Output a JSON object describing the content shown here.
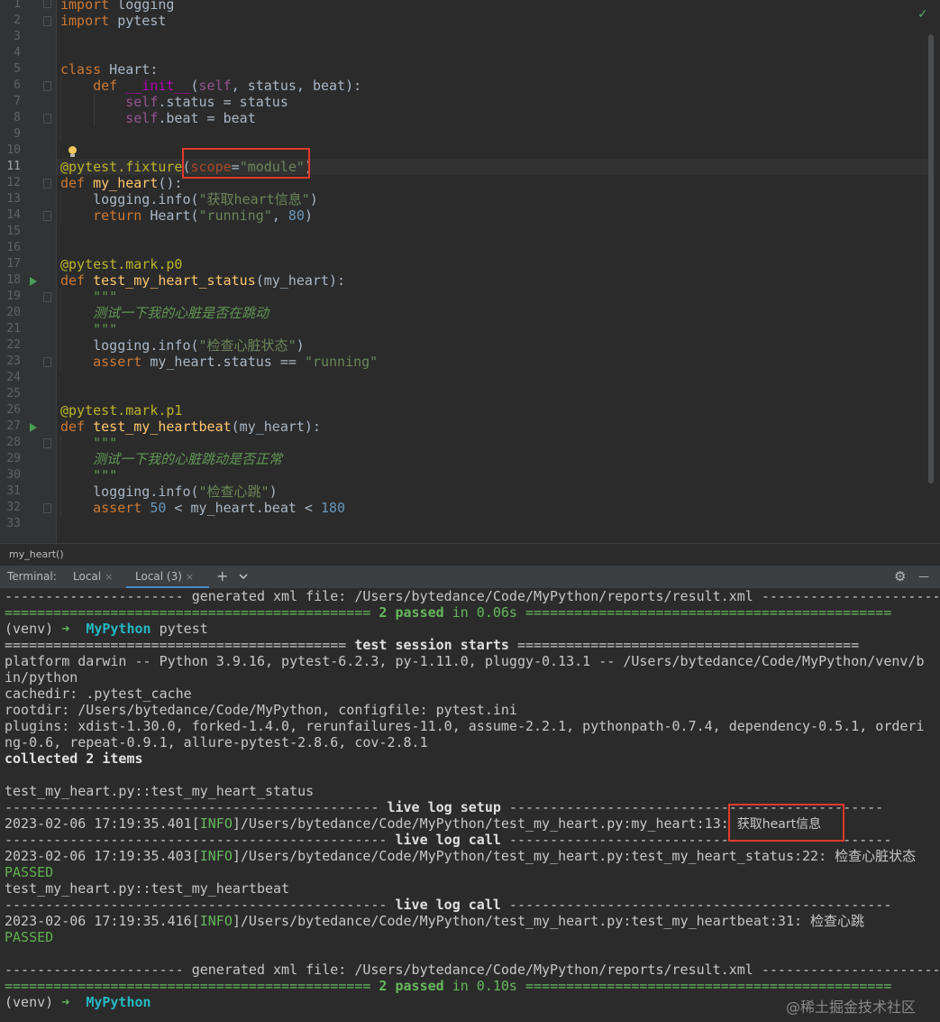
{
  "editor": {
    "line_numbers": [
      "1",
      "2",
      "3",
      "4",
      "5",
      "6",
      "7",
      "8",
      "9",
      "10",
      "11",
      "12",
      "13",
      "14",
      "15",
      "16",
      "17",
      "18",
      "19",
      "20",
      "21",
      "22",
      "23",
      "24",
      "25",
      "26",
      "27",
      "28",
      "29",
      "30",
      "31",
      "32",
      "33"
    ],
    "lines": {
      "l1": [
        "import",
        " logging"
      ],
      "l2": [
        "import",
        " pytest"
      ],
      "l5": [
        "class",
        " Heart:"
      ],
      "l6": [
        "    def ",
        "__init__",
        "(",
        "self",
        ", status, beat):"
      ],
      "l7": [
        "        ",
        "self",
        ".status = status"
      ],
      "l8": [
        "        ",
        "self",
        ".beat = beat"
      ],
      "l11": [
        "@pytest.fixture",
        "(",
        "scope",
        "=",
        "\"module\"",
        ")"
      ],
      "l12": [
        "def ",
        "my_heart",
        "():"
      ],
      "l13": [
        "    logging.info(",
        "\"获取heart信息\"",
        ")"
      ],
      "l14": [
        "    ",
        "return",
        " Heart(",
        "\"running\"",
        ", ",
        "80",
        ")"
      ],
      "l17": [
        "@pytest.mark.p0"
      ],
      "l18": [
        "def ",
        "test_my_heart_status",
        "(my_heart):"
      ],
      "l19": [
        "    \"\"\""
      ],
      "l20": [
        "    测试一下我的心脏是否在跳动"
      ],
      "l21": [
        "    \"\"\""
      ],
      "l22": [
        "    logging.info(",
        "\"检查心脏状态\"",
        ")"
      ],
      "l23": [
        "    ",
        "assert",
        " my_heart.status == ",
        "\"running\""
      ],
      "l26": [
        "@pytest.mark.p1"
      ],
      "l27": [
        "def ",
        "test_my_heartbeat",
        "(my_heart):"
      ],
      "l28": [
        "    \"\"\""
      ],
      "l29": [
        "    测试一下我的心脏跳动是否正常"
      ],
      "l30": [
        "    \"\"\""
      ],
      "l31": [
        "    logging.info(",
        "\"检查心跳\"",
        ")"
      ],
      "l32": [
        "    ",
        "assert",
        " ",
        "50",
        " < my_heart.beat < ",
        "180"
      ]
    },
    "status_icon": "checkmark-icon",
    "colors": {
      "keyword": "#cc7832",
      "function": "#ffc66d",
      "decorator": "#bbb529",
      "string": "#6a8759",
      "number": "#6897bb",
      "highlight_box": "#e03a2e"
    }
  },
  "breadcrumb": {
    "label": "my_heart()"
  },
  "terminal_tabs": {
    "title": "Terminal:",
    "tabs": [
      "Local",
      "Local (3)"
    ],
    "add_icon": "+",
    "dropdown_icon": "chevron-down-icon",
    "settings_icon": "gear-icon",
    "minimize_icon": "—"
  },
  "terminal": {
    "t1": [
      "---------------------- generated xml file: /Users/bytedance/Code/MyPython/reports/result.xml ----------------------"
    ],
    "t2": [
      "============================================= ",
      "2 passed",
      " in 0.06s",
      " ============================================="
    ],
    "t3": [
      "(venv) ",
      "➜",
      "  ",
      "MyPython",
      " pytest"
    ],
    "t4": [
      "========================================== ",
      "test session starts",
      " =========================================="
    ],
    "t5": [
      "platform darwin -- Python 3.9.16, pytest-6.2.3, py-1.11.0, pluggy-0.13.1 -- /Users/bytedance/Code/MyPython/venv/b"
    ],
    "t6": [
      "in/python"
    ],
    "t7": [
      "cachedir: .pytest_cache"
    ],
    "t8": [
      "rootdir: /Users/bytedance/Code/MyPython, configfile: pytest.ini"
    ],
    "t9": [
      "plugins: xdist-1.30.0, forked-1.4.0, rerunfailures-11.0, assume-2.2.1, pythonpath-0.7.4, dependency-0.5.1, orderi"
    ],
    "t10": [
      "ng-0.6, repeat-0.9.1, allure-pytest-2.8.6, cov-2.8.1"
    ],
    "t11": [
      "collected 2 items"
    ],
    "t13": [
      "test_my_heart.py::test_my_heart_status"
    ],
    "t14": [
      "---------------------------------------------- ",
      "live log setup",
      " ----------------------------------------------"
    ],
    "t15": [
      "2023-02-06 17:19:35.401[",
      "INFO",
      "]/Users/bytedance/Code/MyPython/test_my_heart.py:my_heart:13: ",
      "获取heart信息"
    ],
    "t16": [
      "----------------------------------------------- ",
      "live log call",
      " -----------------------------------------------"
    ],
    "t17": [
      "2023-02-06 17:19:35.403[",
      "INFO",
      "]/Users/bytedance/Code/MyPython/test_my_heart.py:test_my_heart_status:22: 检查心脏状态"
    ],
    "t18": [
      "PASSED"
    ],
    "t19": [
      "test_my_heart.py::test_my_heartbeat"
    ],
    "t20": [
      "----------------------------------------------- ",
      "live log call",
      " -----------------------------------------------"
    ],
    "t21": [
      "2023-02-06 17:19:35.416[",
      "INFO",
      "]/Users/bytedance/Code/MyPython/test_my_heart.py:test_my_heartbeat:31: 检查心跳"
    ],
    "t22": [
      "PASSED"
    ],
    "t24": [
      "---------------------- generated xml file: /Users/bytedance/Code/MyPython/reports/result.xml ----------------------"
    ],
    "t25": [
      "============================================= ",
      "2 passed",
      " in 0.10s",
      " ============================================="
    ],
    "t26": [
      "(venv) ",
      "➜",
      "  ",
      "MyPython"
    ]
  },
  "watermark": "@稀土掘金技术社区"
}
